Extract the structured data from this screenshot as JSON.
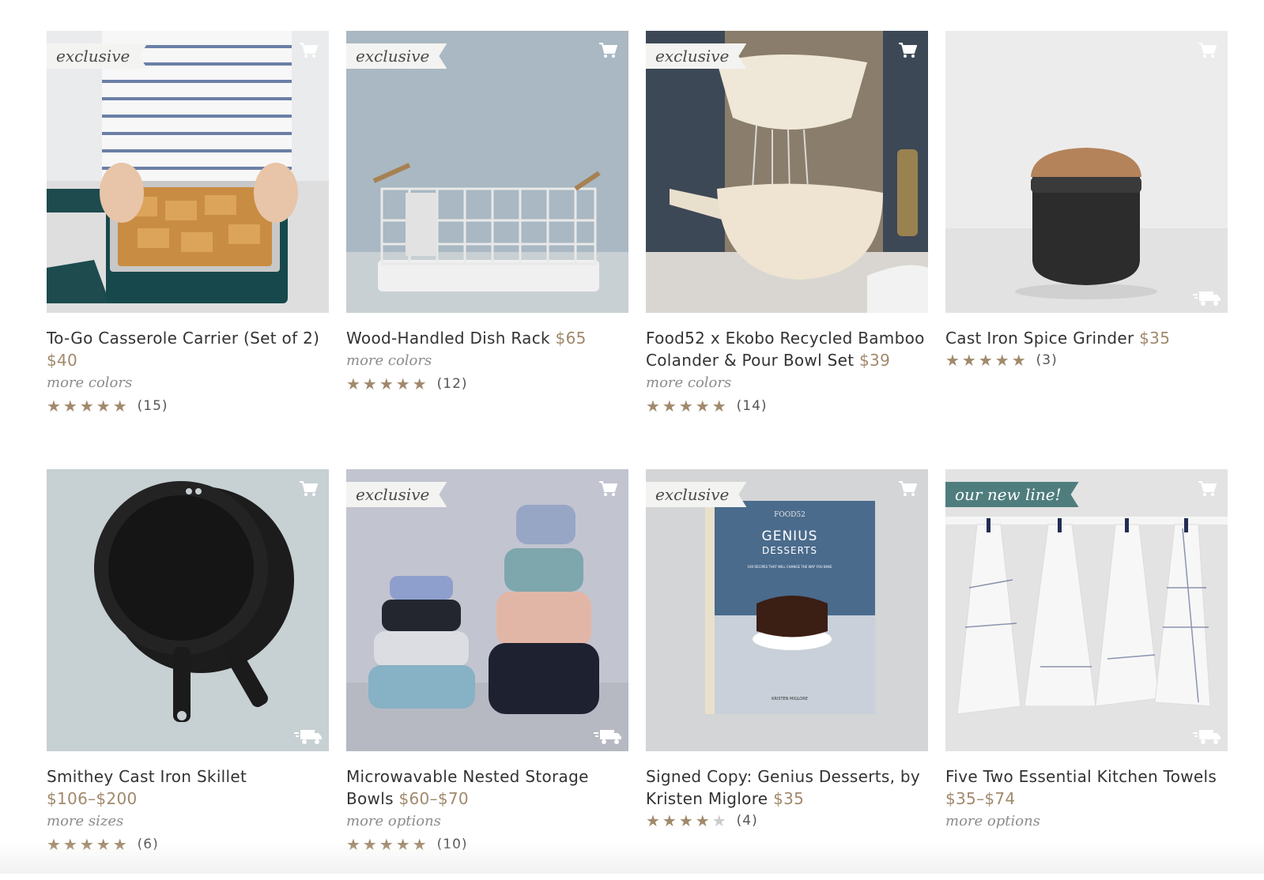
{
  "products": [
    {
      "name": "To-Go Casserole Carrier (Set of 2)",
      "price": "$40",
      "flag": "exclusive",
      "more": "more colors",
      "rating": 4.5,
      "stars_display": "★★★★★",
      "reviews": "(15)",
      "cart_icon": "cart-icon",
      "truck_icon": ""
    },
    {
      "name": "Wood-Handled Dish Rack",
      "price": "$65",
      "flag": "exclusive",
      "more": "more colors",
      "rating": 4.5,
      "stars_display": "★★★★★",
      "reviews": "(12)",
      "cart_icon": "cart-icon",
      "truck_icon": ""
    },
    {
      "name": "Food52 x Ekobo Recycled Bamboo Colander & Pour Bowl Set",
      "price": "$39",
      "flag": "exclusive",
      "more": "more colors",
      "rating": 5,
      "stars_display": "★★★★★",
      "reviews": "(14)",
      "cart_icon": "cart-icon",
      "truck_icon": ""
    },
    {
      "name": "Cast Iron Spice Grinder",
      "price": "$35",
      "flag": "",
      "more": "",
      "rating": 5,
      "stars_display": "★★★★★",
      "reviews": "(3)",
      "cart_icon": "cart-icon",
      "truck_icon": "delivery-truck-icon"
    },
    {
      "name": "Smithey Cast Iron Skillet",
      "price": "$106–$200",
      "flag": "",
      "more": "more sizes",
      "rating": 4.5,
      "stars_display": "★★★★★",
      "reviews": "(6)",
      "cart_icon": "cart-icon",
      "truck_icon": "delivery-truck-icon"
    },
    {
      "name": "Microwavable Nested Storage Bowls",
      "price": "$60–$70",
      "flag": "exclusive",
      "more": "more options",
      "rating": 4.5,
      "stars_display": "★★★★★",
      "reviews": "(10)",
      "cart_icon": "cart-icon",
      "truck_icon": "delivery-truck-icon"
    },
    {
      "name": "Signed Copy: Genius Desserts, by Kristen Miglore",
      "price": "$35",
      "flag": "exclusive",
      "more": "",
      "rating": 4,
      "stars_display": "★★★★",
      "stars_off": "★",
      "reviews": "(4)",
      "cart_icon": "cart-icon",
      "truck_icon": ""
    },
    {
      "name": "Five Two Essential Kitchen Towels",
      "price": "$35–$74",
      "flag": "our new line!",
      "more": "more options",
      "rating": null,
      "stars_display": "",
      "reviews": "",
      "cart_icon": "cart-icon",
      "truck_icon": "delivery-truck-icon"
    }
  ],
  "book_cover": {
    "brand": "FOOD52",
    "title_line1": "GENIUS",
    "title_line2": "DESSERTS",
    "subtitle": "100 RECIPES THAT WILL CHANGE THE WAY YOU BAKE",
    "author": "KRISTEN MIGLORE"
  },
  "colors": {
    "price": "#a1896c",
    "star": "#a1896c",
    "flag_bg": "#f3f3f1",
    "new_line_flag_bg": "#4f7d7e"
  }
}
